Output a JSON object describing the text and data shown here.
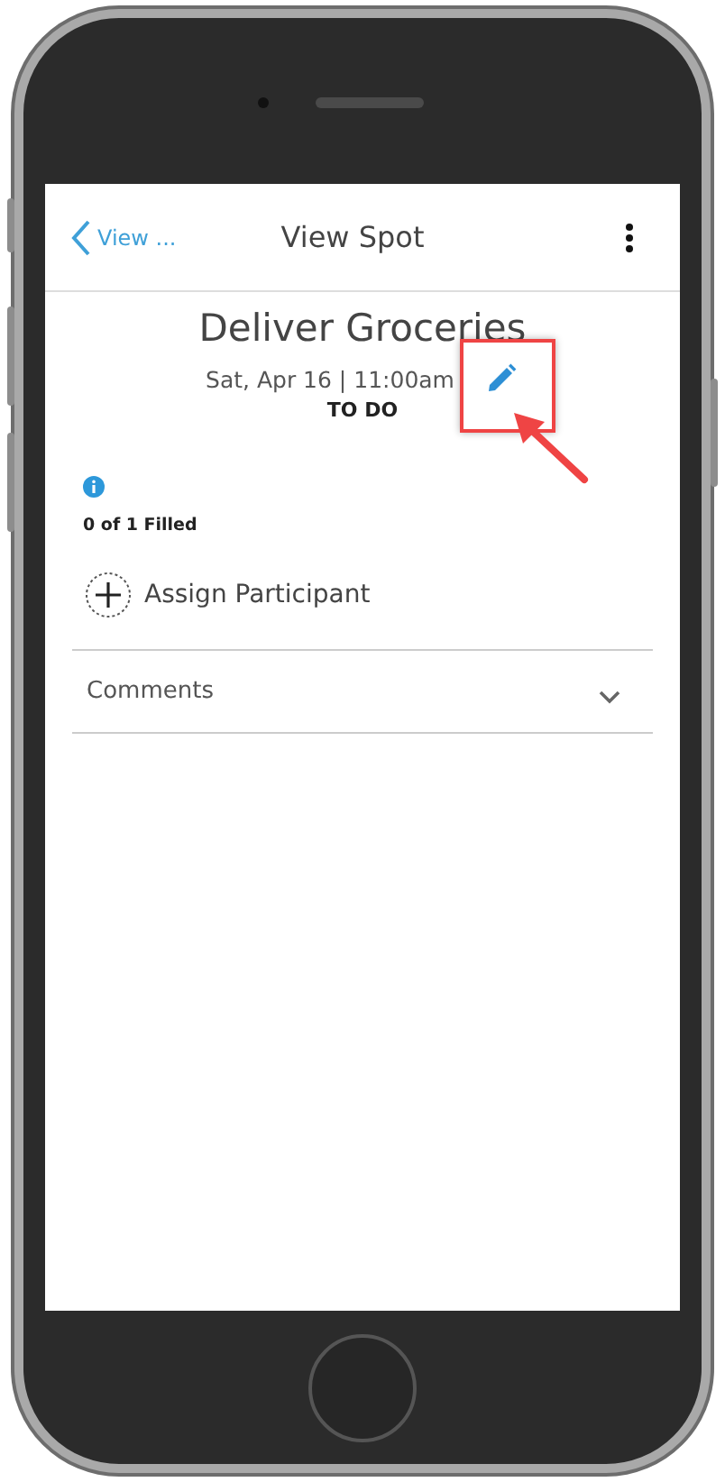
{
  "header": {
    "back_label": "View ...",
    "title": "View Spot"
  },
  "spot": {
    "title": "Deliver Groceries",
    "datetime": "Sat, Apr 16 | 11:00am",
    "status": "TO DO",
    "filled": "0 of 1 Filled"
  },
  "assign_label": "Assign Participant",
  "comments": {
    "label": "Comments",
    "expanded": false
  }
}
